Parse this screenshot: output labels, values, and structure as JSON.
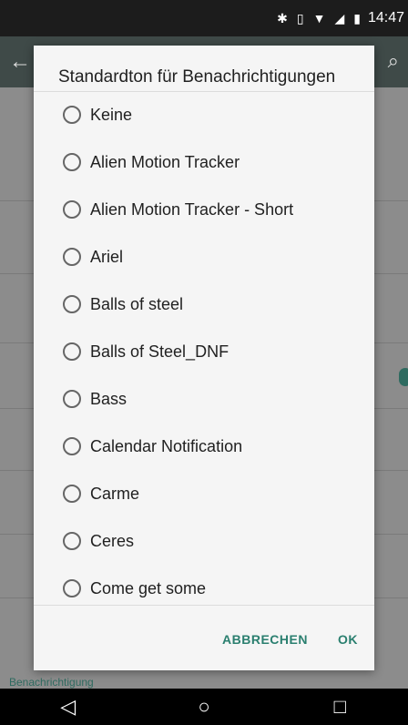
{
  "status_bar": {
    "icons": [
      "bluetooth-icon",
      "vibrate-icon",
      "wifi-icon",
      "signal-icon",
      "battery-icon"
    ],
    "time": "14:47"
  },
  "dialog": {
    "title": "Standardton für Benachrichtigungen",
    "options": [
      "Keine",
      "Alien Motion Tracker",
      "Alien Motion Tracker - Short",
      "Ariel",
      "Balls of steel",
      "Balls of Steel_DNF",
      "Bass",
      "Calendar Notification",
      "Carme",
      "Ceres",
      "Come get some"
    ],
    "cancel_label": "ABBRECHEN",
    "ok_label": "OK"
  },
  "background": {
    "section_bottom": "Benachrichtigung"
  },
  "colors": {
    "accent": "#2a7f6f",
    "appbar": "#3f4a48",
    "dialog_bg": "#f5f5f5"
  }
}
